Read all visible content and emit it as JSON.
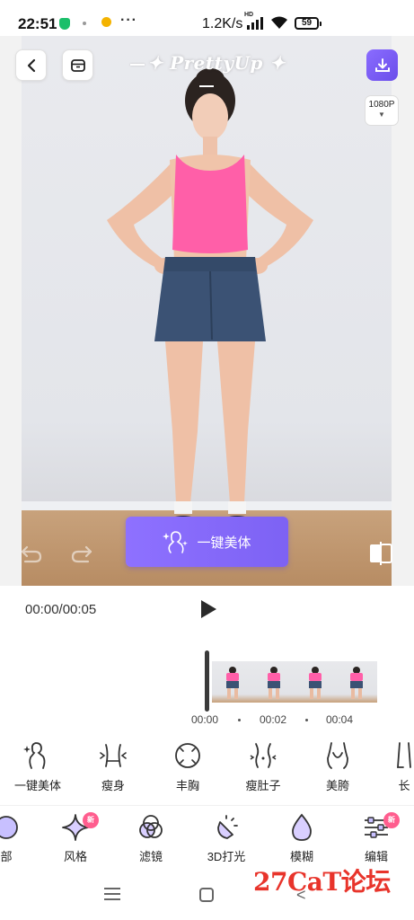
{
  "status_bar": {
    "time": "22:51",
    "more": "···",
    "net_speed": "1.2K/s",
    "hd": "HD",
    "battery": "59"
  },
  "header": {
    "brand": "PrettyUp",
    "brand_decor": "✦",
    "resolution": "1080P",
    "resolution_arrow": "▼"
  },
  "preview": {
    "one_key_label": "一键美体"
  },
  "playback": {
    "time": "00:00/00:05",
    "ticks": [
      "00:00",
      "00:02",
      "00:04"
    ],
    "frame_count": 4
  },
  "tools": [
    {
      "label": "一键美体",
      "icon": "body-outline-icon"
    },
    {
      "label": "瘦身",
      "icon": "slim-waist-icon"
    },
    {
      "label": "丰胸",
      "icon": "enhance-chest-icon"
    },
    {
      "label": "瘦肚子",
      "icon": "slim-belly-icon"
    },
    {
      "label": "美胯",
      "icon": "hip-icon"
    },
    {
      "label": "长",
      "icon": "leg-length-icon"
    }
  ],
  "tabs": [
    {
      "label": "部",
      "icon": "partial-icon"
    },
    {
      "label": "风格",
      "icon": "sparkle-icon",
      "badge": "新"
    },
    {
      "label": "滤镜",
      "icon": "filter-icon"
    },
    {
      "label": "3D打光",
      "icon": "lighting-icon"
    },
    {
      "label": "模糊",
      "icon": "blur-drop-icon"
    },
    {
      "label": "编辑",
      "icon": "sliders-icon",
      "badge": "新"
    }
  ],
  "watermark": "27CaT论坛",
  "colors": {
    "accent": "#7d62f4",
    "badge": "#ff5d8e",
    "top_shirt": "#ff5fa8",
    "skirt": "#3b5274",
    "watermark": "#e8342b"
  }
}
